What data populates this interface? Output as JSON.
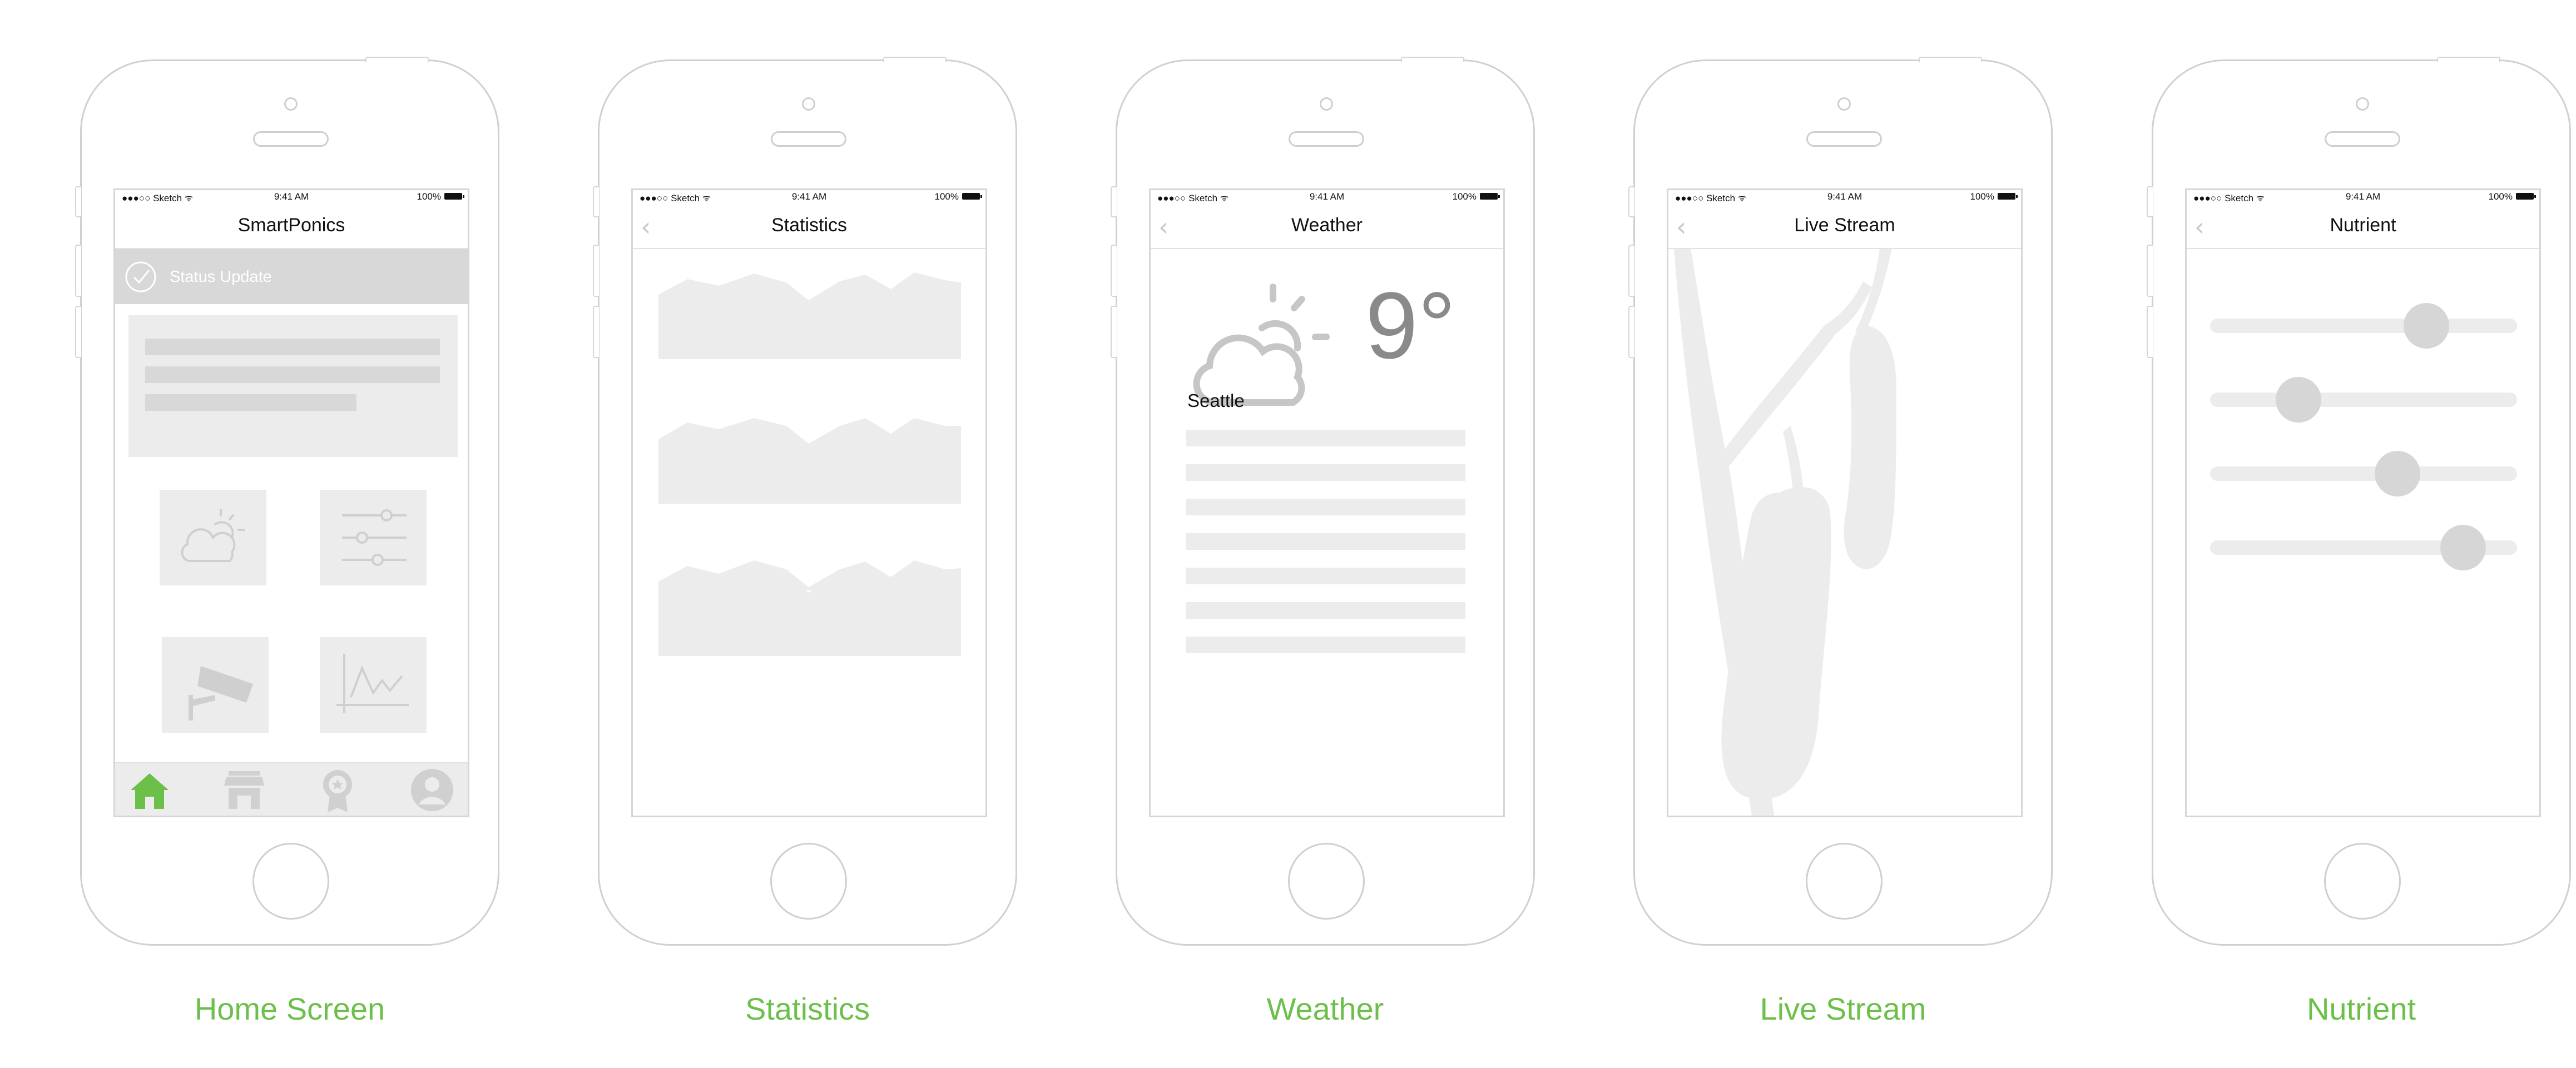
{
  "status_bar": {
    "carrier": "●●●○○ Sketch ᯤ",
    "time": "9:41 AM",
    "battery": "100%"
  },
  "screens": {
    "home": {
      "caption": "Home Screen",
      "title": "SmartPonics",
      "status_update": "Status Update",
      "tiles": [
        "weather-icon",
        "sliders-icon",
        "camera-icon",
        "chart-icon"
      ],
      "tab_bar": [
        "home-icon",
        "store-icon",
        "badge-icon",
        "profile-icon"
      ],
      "accent_color": "#6cc04a"
    },
    "statistics": {
      "caption": "Statistics",
      "title": "Statistics"
    },
    "weather": {
      "caption": "Weather",
      "title": "Weather",
      "temperature": "9°",
      "city": "Seattle"
    },
    "live_stream": {
      "caption": "Live Stream",
      "title": "Live Stream"
    },
    "nutrient": {
      "caption": "Nutrient",
      "title": "Nutrient",
      "slider_values": [
        0.74,
        0.25,
        0.63,
        0.88
      ]
    }
  }
}
